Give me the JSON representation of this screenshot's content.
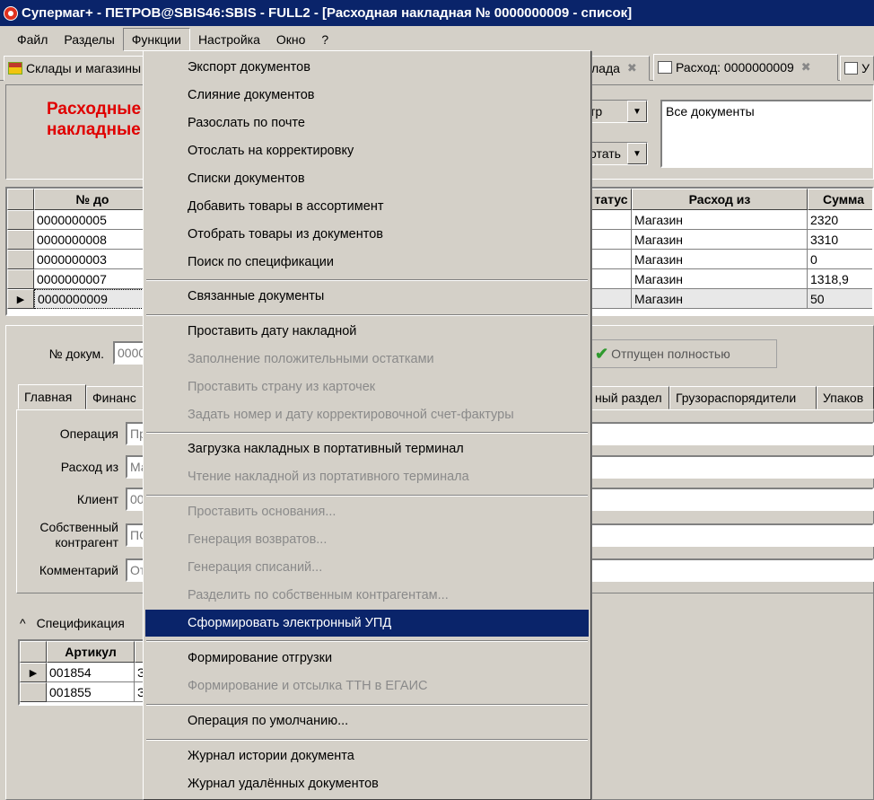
{
  "window": {
    "title": "Супермаг+ - ПЕТРОВ@SBIS46:SBIS - FULL2  - [Расходная накладная № 0000000009 - список]"
  },
  "menubar": [
    "Файл",
    "Разделы",
    "Функции",
    "Настройка",
    "Окно",
    "?"
  ],
  "doc_tabs": [
    {
      "label": "Склады и магазины"
    },
    {
      "label": "лада"
    },
    {
      "label": "Расход: 0000000009"
    },
    {
      "label": "У"
    }
  ],
  "header": {
    "title_line1": "Расходные",
    "title_line2": "накладные",
    "filter_combo": "тр",
    "print_combo": "отать",
    "memo": "Все документы"
  },
  "grid": {
    "columns": [
      "№ до",
      "татус",
      "Расход из",
      "Сумма"
    ],
    "rows": [
      {
        "num": "0000000005",
        "status": "",
        "from": "Магазин",
        "sum": "2320"
      },
      {
        "num": "0000000008",
        "status": "",
        "from": "Магазин",
        "sum": "3310"
      },
      {
        "num": "0000000003",
        "status": "",
        "from": "Магазин",
        "sum": "0"
      },
      {
        "num": "0000000007",
        "status": "",
        "from": "Магазин",
        "sum": "1318,9"
      },
      {
        "num": "0000000009",
        "status": "",
        "from": "Магазин",
        "sum": "50"
      }
    ]
  },
  "form": {
    "docnum_label": "№ докум.",
    "docnum_value": "0000",
    "status_text": "Отпущен полностью",
    "tabs": [
      "Главная",
      "Финанс",
      "ный раздел",
      "Грузораспорядители",
      "Упаков"
    ],
    "fields": [
      {
        "label": "Операция",
        "value": "Пр"
      },
      {
        "label": "Расход из",
        "value": "Ма"
      },
      {
        "label": "Клиент",
        "value": "00"
      },
      {
        "label": "Собственный",
        "label2": "контрагент",
        "value": "ПС"
      },
      {
        "label": "Комментарий",
        "value": "От"
      }
    ]
  },
  "spec": {
    "caret": "^",
    "title": "Спецификация",
    "col": "Артикул",
    "rows": [
      {
        "art": "001854",
        "x": "З"
      },
      {
        "art": "001855",
        "x": "З"
      }
    ]
  },
  "functions_menu": [
    {
      "label": "Экспорт документов",
      "disabled": false
    },
    {
      "label": "Слияние документов",
      "disabled": false
    },
    {
      "label": "Разослать по почте",
      "disabled": false
    },
    {
      "label": "Отослать на корректировку",
      "disabled": false
    },
    {
      "label": "Списки документов",
      "disabled": false
    },
    {
      "label": "Добавить товары в ассортимент",
      "disabled": false
    },
    {
      "label": "Отобрать товары из документов",
      "disabled": false
    },
    {
      "label": "Поиск по спецификации",
      "disabled": false
    },
    {
      "label": "Связанные документы",
      "disabled": false
    },
    {
      "label": "Проставить дату накладной",
      "disabled": false
    },
    {
      "label": "Заполнение положительными остатками",
      "disabled": true
    },
    {
      "label": "Проставить страну из карточек",
      "disabled": true
    },
    {
      "label": "Задать номер и дату корректировочной счет-фактуры",
      "disabled": true
    },
    {
      "label": "Загрузка накладных в портативный терминал",
      "disabled": false
    },
    {
      "label": "Чтение накладной из портативного терминала",
      "disabled": true
    },
    {
      "label": "Проставить основания...",
      "disabled": true
    },
    {
      "label": "Генерация возвратов...",
      "disabled": true
    },
    {
      "label": "Генерация списаний...",
      "disabled": true
    },
    {
      "label": "Разделить по собственным контрагентам...",
      "disabled": true
    },
    {
      "label": "Сформировать электронный УПД",
      "disabled": false,
      "highlighted": true
    },
    {
      "label": "Формирование отгрузки",
      "disabled": false
    },
    {
      "label": "Формирование и отсылка ТТН в ЕГАИС",
      "disabled": true
    },
    {
      "label": "Операция по умолчанию...",
      "disabled": false
    },
    {
      "label": "Журнал истории документа",
      "disabled": false
    },
    {
      "label": "Журнал удалённых документов",
      "disabled": false
    }
  ]
}
